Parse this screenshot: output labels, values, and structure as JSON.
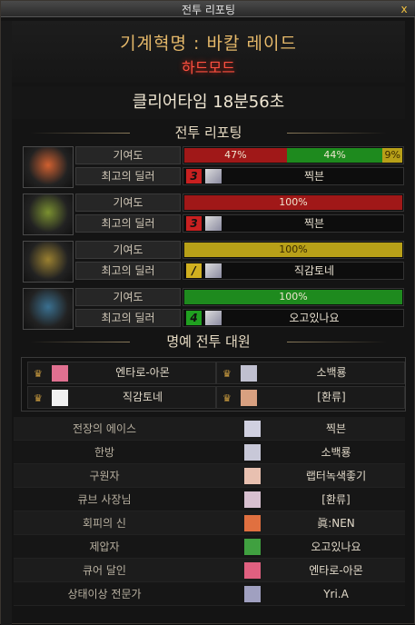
{
  "window": {
    "title": "전투 리포팅",
    "close_label": "x"
  },
  "header": {
    "dungeon_name": "기계혁명 : 바칼 레이드",
    "mode": "하드모드"
  },
  "clear_time": "클리어타임  18분56초",
  "section_report": "전투 리포팅",
  "section_honor": "명예 전투 대원",
  "labels": {
    "contribution": "기여도",
    "top_dealer": "최고의 딜러"
  },
  "parties": [
    {
      "icon": "red-helmet-icon",
      "color": "#d06030",
      "bars": [
        {
          "pct": 47,
          "label": "47%",
          "color": "#a01818"
        },
        {
          "pct": 44,
          "label": "44%",
          "color": "#1e8a1e"
        },
        {
          "pct": 9,
          "label": "9%",
          "color": "#b8a018"
        }
      ],
      "rank_num": "3",
      "rank_color": "#c82020",
      "dealer": "찍븐"
    },
    {
      "icon": "green-helmet-icon",
      "color": "#7a9030",
      "bars": [
        {
          "pct": 100,
          "label": "100%",
          "color": "#a01818"
        }
      ],
      "rank_num": "3",
      "rank_color": "#c82020",
      "dealer": "찍븐"
    },
    {
      "icon": "gold-helmet-icon",
      "color": "#9a8030",
      "bars": [
        {
          "pct": 100,
          "label": "100%",
          "color": "#b8a018"
        }
      ],
      "rank_num": "/",
      "rank_color": "#d0b020",
      "dealer": "직감토네"
    },
    {
      "icon": "blue-helmet-icon",
      "color": "#3a7090",
      "bars": [
        {
          "pct": 100,
          "label": "100%",
          "color": "#1e8a1e"
        }
      ],
      "rank_num": "4",
      "rank_color": "#20a020",
      "dealer": "오고있나요"
    }
  ],
  "honor": [
    {
      "name": "엔타로-아몬"
    },
    {
      "name": "소백룡"
    },
    {
      "name": "직감토네"
    },
    {
      "name": "[환류]"
    }
  ],
  "awards": [
    {
      "title": "전장의 에이스",
      "player": "찍븐"
    },
    {
      "title": "한방",
      "player": "소백룡"
    },
    {
      "title": "구원자",
      "player": "랩터녹색좋기"
    },
    {
      "title": "큐브 사장님",
      "player": "[환류]"
    },
    {
      "title": "회피의 신",
      "player": "眞:NEN"
    },
    {
      "title": "제압자",
      "player": "오고있나요"
    },
    {
      "title": "큐어 달인",
      "player": "엔타로-아몬"
    },
    {
      "title": "상태이상 전문가",
      "player": "Yri.A"
    }
  ]
}
